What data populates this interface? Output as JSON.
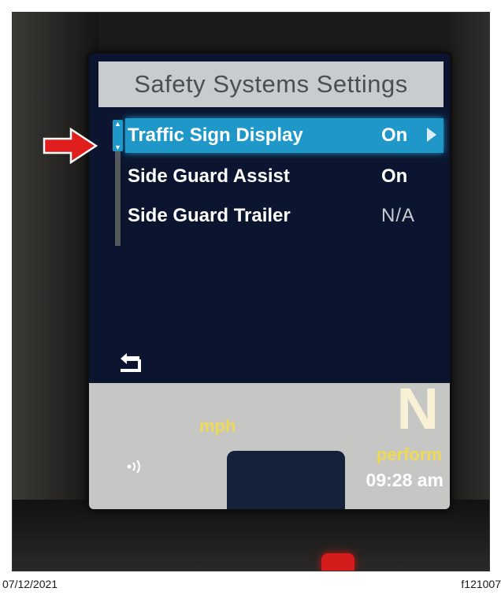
{
  "screen": {
    "title": "Safety Systems Settings",
    "menu_items": [
      {
        "label": "Traffic Sign Display",
        "value": "On"
      },
      {
        "label": "Side Guard Assist",
        "value": "On"
      },
      {
        "label": "Side Guard Trailer",
        "value": "N/A"
      }
    ],
    "selected_index": 0
  },
  "status_bar": {
    "speed_unit": "mph",
    "gear": "N",
    "mode": "perform",
    "time": "09:28 am"
  },
  "caption": {
    "date": "07/12/2021",
    "figure_id": "f121007"
  },
  "colors": {
    "highlight": "#1f98c9",
    "screen_bg": "#0b1530",
    "title_bar": "#c9ccce",
    "status_text": "#eeda55",
    "pointer_arrow": "#e01e1e"
  },
  "icons": [
    "back-arrow-icon",
    "signal-icon",
    "submenu-arrow-icon",
    "scroll-up-icon",
    "scroll-down-icon",
    "pointer-arrow-icon"
  ]
}
